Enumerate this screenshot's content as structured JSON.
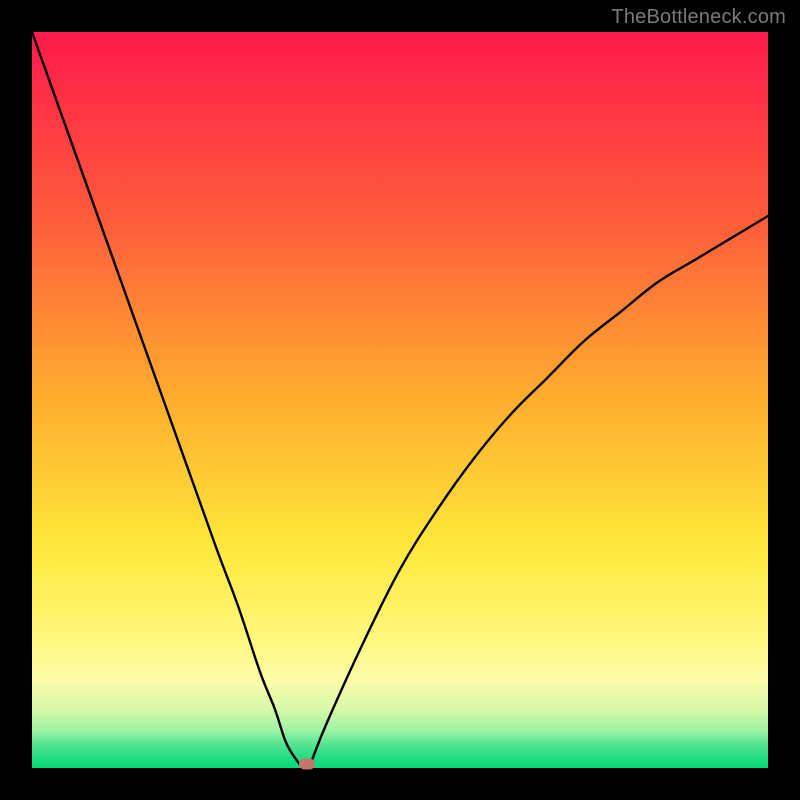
{
  "watermark": "TheBottleneck.com",
  "chart_data": {
    "type": "line",
    "title": "",
    "xlabel": "",
    "ylabel": "",
    "xlim": [
      0,
      100
    ],
    "ylim": [
      0,
      100
    ],
    "grid": false,
    "series": [
      {
        "name": "bottleneck-curve",
        "x": [
          0,
          5,
          10,
          15,
          20,
          25,
          28,
          31,
          33,
          34.5,
          36,
          36.9,
          37.4,
          38,
          40,
          45,
          50,
          55,
          60,
          65,
          70,
          75,
          80,
          85,
          90,
          95,
          100
        ],
        "values": [
          100,
          86,
          72,
          58,
          44,
          30,
          22,
          13,
          8,
          3.5,
          1,
          0,
          0,
          1,
          6,
          17,
          27,
          35,
          42,
          48,
          53,
          58,
          62,
          66,
          69,
          72,
          75
        ]
      }
    ],
    "marker": {
      "x": 37.4,
      "y": 0.5,
      "color": "#c4766e"
    },
    "background_gradient": {
      "stops": [
        {
          "pos": 0,
          "color": "#ff1a4b"
        },
        {
          "pos": 25,
          "color": "#ff5a3c"
        },
        {
          "pos": 50,
          "color": "#ffae2e"
        },
        {
          "pos": 70,
          "color": "#ffe83a"
        },
        {
          "pos": 82,
          "color": "#fff77a"
        },
        {
          "pos": 88,
          "color": "#fdfca8"
        },
        {
          "pos": 92,
          "color": "#d6f9a8"
        },
        {
          "pos": 95,
          "color": "#9cf2a6"
        },
        {
          "pos": 97,
          "color": "#4de28e"
        },
        {
          "pos": 100,
          "color": "#00d977"
        }
      ]
    }
  }
}
